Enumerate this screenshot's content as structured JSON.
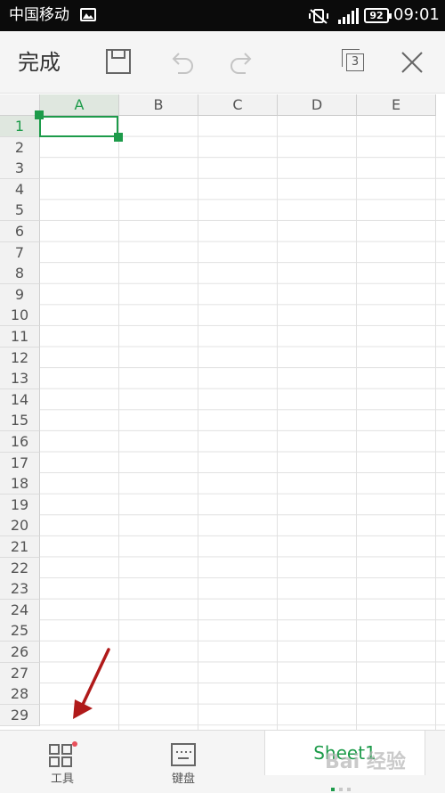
{
  "status_bar": {
    "carrier": "中国移动",
    "battery": "92",
    "time": "09:01"
  },
  "toolbar": {
    "done_label": "完成",
    "sheet_count": "3"
  },
  "grid": {
    "columns": [
      "A",
      "B",
      "C",
      "D",
      "E"
    ],
    "rows": [
      "1",
      "2",
      "3",
      "4",
      "5",
      "6",
      "7",
      "8",
      "9",
      "10",
      "11",
      "12",
      "13",
      "14",
      "15",
      "16",
      "17",
      "18",
      "19",
      "20",
      "21",
      "22",
      "23",
      "24",
      "25",
      "26",
      "27",
      "28",
      "29"
    ],
    "active_column": "A",
    "active_row": "1"
  },
  "bottom_bar": {
    "tools_label": "工具",
    "keyboard_label": "键盘",
    "sheet_tab": "Sheet1",
    "watermark": "Bai 经验"
  },
  "colors": {
    "accent": "#1d9b4a",
    "notification_dot": "#e8505b",
    "annotation_arrow": "#b01a1a"
  }
}
